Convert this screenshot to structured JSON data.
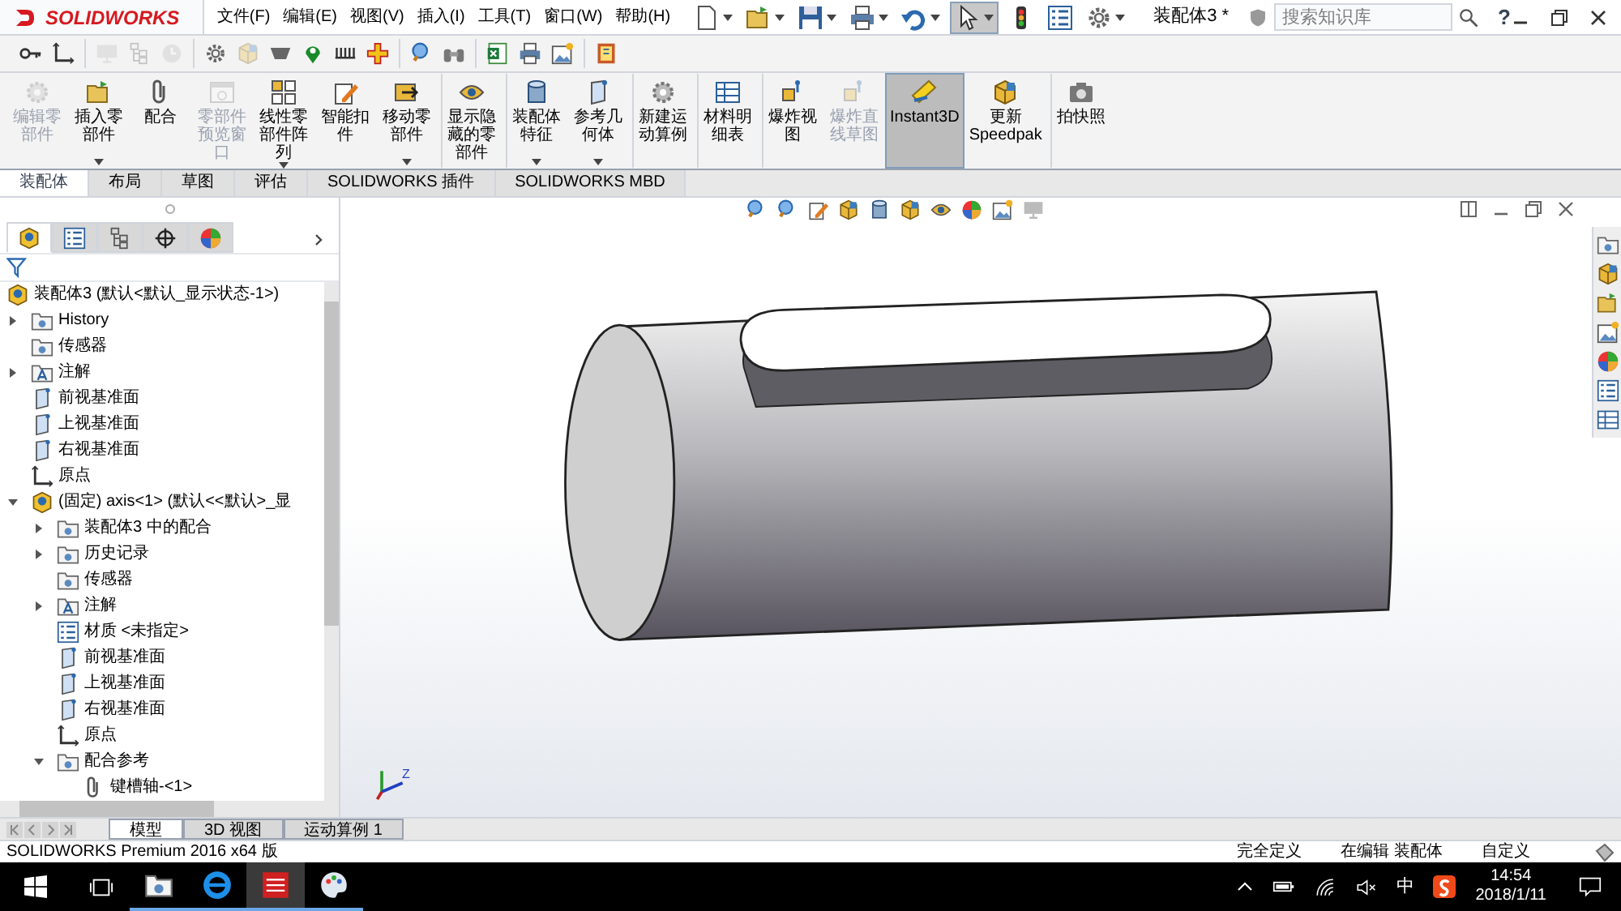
{
  "title_bar": {
    "logo": "SOLIDWORKS",
    "menu": [
      "文件(F)",
      "编辑(E)",
      "视图(V)",
      "插入(I)",
      "工具(T)",
      "窗口(W)",
      "帮助(H)"
    ],
    "quick_icons": [
      {
        "kind": "new-document",
        "selected": false,
        "dropdown": true
      },
      {
        "kind": "open-folder",
        "selected": false,
        "dropdown": true
      },
      {
        "kind": "floppy-disk",
        "selected": false,
        "dropdown": true
      },
      {
        "kind": "printer",
        "selected": false,
        "dropdown": true
      },
      {
        "kind": "undo-arrow",
        "selected": false,
        "dropdown": true
      },
      {
        "kind": "pointer",
        "selected": true,
        "dropdown": true
      },
      {
        "kind": "traffic-light",
        "selected": false,
        "dropdown": false
      },
      {
        "kind": "list",
        "selected": false,
        "dropdown": false
      },
      {
        "kind": "gear",
        "selected": false,
        "dropdown": true
      }
    ],
    "document_title": "装配体3 *",
    "search": {
      "placeholder": "搜索知识库"
    },
    "help": "?"
  },
  "toolbar": [
    {
      "kind": "key",
      "disabled": false,
      "separator_before": false
    },
    {
      "kind": "corner",
      "disabled": false,
      "separator_before": false
    },
    {
      "kind": "monitor",
      "disabled": true,
      "separator_before": true
    },
    {
      "kind": "hierarchy",
      "disabled": true,
      "separator_before": false
    },
    {
      "kind": "clock",
      "disabled": true,
      "separator_before": false
    },
    {
      "kind": "gear",
      "disabled": false,
      "separator_before": true
    },
    {
      "kind": "cube",
      "disabled": true,
      "separator_before": false
    },
    {
      "kind": "bowl",
      "disabled": false,
      "separator_before": false
    },
    {
      "kind": "map-pin",
      "disabled": false,
      "separator_before": false
    },
    {
      "kind": "comb",
      "disabled": false,
      "separator_before": false
    },
    {
      "kind": "cross",
      "disabled": false,
      "separator_before": false
    },
    {
      "kind": "magnifier",
      "disabled": false,
      "separator_before": true
    },
    {
      "kind": "binoculars",
      "disabled": false,
      "separator_before": false
    },
    {
      "kind": "spreadsheet",
      "disabled": false,
      "separator_before": true
    },
    {
      "kind": "printer",
      "disabled": false,
      "separator_before": false
    },
    {
      "kind": "picture",
      "disabled": false,
      "separator_before": false
    },
    {
      "kind": "book",
      "disabled": false,
      "separator_before": true
    }
  ],
  "ribbon": [
    {
      "label": "编辑零部件",
      "kind": "cog",
      "disabled": true,
      "selected": false,
      "dropdown": false,
      "separator_before": false
    },
    {
      "label": "插入零部件",
      "kind": "open-folder",
      "disabled": false,
      "selected": false,
      "dropdown": true,
      "separator_before": false
    },
    {
      "label": "配合",
      "kind": "paperclip",
      "disabled": false,
      "selected": false,
      "dropdown": false,
      "separator_before": false
    },
    {
      "label": "零部件预览窗口",
      "kind": "window",
      "disabled": true,
      "selected": false,
      "dropdown": false,
      "separator_before": false
    },
    {
      "label": "线性零部件阵列",
      "kind": "grid",
      "disabled": false,
      "selected": false,
      "dropdown": true,
      "separator_before": false
    },
    {
      "label": "智能扣件",
      "kind": "pencil-document",
      "disabled": false,
      "selected": false,
      "dropdown": false,
      "separator_before": false
    },
    {
      "label": "移动零部件",
      "kind": "arrow-box",
      "disabled": false,
      "selected": false,
      "dropdown": true,
      "separator_before": false
    },
    {
      "label": "显示隐藏的零部件",
      "kind": "eye",
      "disabled": false,
      "selected": false,
      "dropdown": false,
      "separator_before": true
    },
    {
      "label": "装配体特征",
      "kind": "cylinder",
      "disabled": false,
      "selected": false,
      "dropdown": true,
      "separator_before": true
    },
    {
      "label": "参考几何体",
      "kind": "plane",
      "disabled": false,
      "selected": false,
      "dropdown": true,
      "separator_before": false
    },
    {
      "label": "新建运动算例",
      "kind": "cog",
      "disabled": false,
      "selected": false,
      "dropdown": false,
      "separator_before": true
    },
    {
      "label": "材料明细表",
      "kind": "table",
      "disabled": false,
      "selected": false,
      "dropdown": false,
      "separator_before": true
    },
    {
      "label": "爆炸视图",
      "kind": "explode",
      "disabled": false,
      "selected": false,
      "dropdown": false,
      "separator_before": true
    },
    {
      "label": "爆炸直线草图",
      "kind": "explode",
      "disabled": true,
      "selected": false,
      "dropdown": false,
      "separator_before": false
    },
    {
      "label": "Instant3D",
      "kind": "ruler",
      "disabled": false,
      "selected": true,
      "dropdown": false,
      "separator_before": false
    },
    {
      "label": "更新 Speedpak",
      "kind": "cube",
      "disabled": false,
      "selected": false,
      "dropdown": false,
      "separator_before": false
    },
    {
      "label": "拍快照",
      "kind": "camera",
      "disabled": false,
      "selected": false,
      "dropdown": false,
      "separator_before": true
    }
  ],
  "command_tabs": [
    {
      "label": "装配体",
      "selected": true
    },
    {
      "label": "布局",
      "selected": false
    },
    {
      "label": "草图",
      "selected": false
    },
    {
      "label": "评估",
      "selected": false
    },
    {
      "label": "SOLIDWORKS 插件",
      "selected": false
    },
    {
      "label": "SOLIDWORKS MBD",
      "selected": false
    }
  ],
  "feature_manager": {
    "panel_tabs": [
      {
        "kind": "part",
        "selected": true
      },
      {
        "kind": "list",
        "selected": false
      },
      {
        "kind": "hierarchy",
        "selected": false
      },
      {
        "kind": "crosshair",
        "selected": false
      },
      {
        "kind": "color-wheel",
        "selected": false
      }
    ],
    "tree": [
      {
        "label": "装配体3  (默认<默认_显示状态-1>)",
        "kind": "part",
        "children": [
          {
            "label": "History",
            "kind": "folder",
            "expanded": false
          },
          {
            "label": "传感器",
            "kind": "folder"
          },
          {
            "label": "注解",
            "kind": "annotation",
            "expanded": false
          },
          {
            "label": "前视基准面",
            "kind": "plane"
          },
          {
            "label": "上视基准面",
            "kind": "plane"
          },
          {
            "label": "右视基准面",
            "kind": "plane"
          },
          {
            "label": "原点",
            "kind": "corner"
          },
          {
            "label": "(固定) axis<1> (默认<<默认>_显",
            "kind": "part",
            "expanded": true,
            "children": [
              {
                "label": "装配体3 中的配合",
                "kind": "folder",
                "expanded": false
              },
              {
                "label": "历史记录",
                "kind": "folder",
                "expanded": false
              },
              {
                "label": "传感器",
                "kind": "folder"
              },
              {
                "label": "注解",
                "kind": "annotation",
                "expanded": false
              },
              {
                "label": "材质 <未指定>",
                "kind": "list"
              },
              {
                "label": "前视基准面",
                "kind": "plane"
              },
              {
                "label": "上视基准面",
                "kind": "plane"
              },
              {
                "label": "右视基准面",
                "kind": "plane"
              },
              {
                "label": "原点",
                "kind": "corner"
              },
              {
                "label": "配合参考",
                "kind": "folder",
                "expanded": true,
                "children": [
                  {
                    "label": "键槽轴-<1>",
                    "kind": "paperclip"
                  }
                ]
              }
            ]
          }
        ]
      }
    ]
  },
  "viewport": {
    "triad_label": "Z"
  },
  "bottom_tabs": [
    {
      "label": "模型",
      "selected": true
    },
    {
      "label": "3D 视图",
      "selected": false
    },
    {
      "label": "运动算例 1",
      "selected": false
    }
  ],
  "status_bar": {
    "product": "SOLIDWORKS Premium 2016 x64 版",
    "fields": [
      "完全定义",
      "在编辑 装配体",
      "自定义"
    ]
  },
  "taskbar": {
    "apps": [
      {
        "kind": "folder",
        "selected": false
      },
      {
        "kind": "browser",
        "selected": false
      },
      {
        "kind": "cad-app",
        "selected": true
      },
      {
        "kind": "palette",
        "selected": false
      }
    ],
    "input_method": "中",
    "time": "14:54",
    "date": "2018/1/11"
  }
}
